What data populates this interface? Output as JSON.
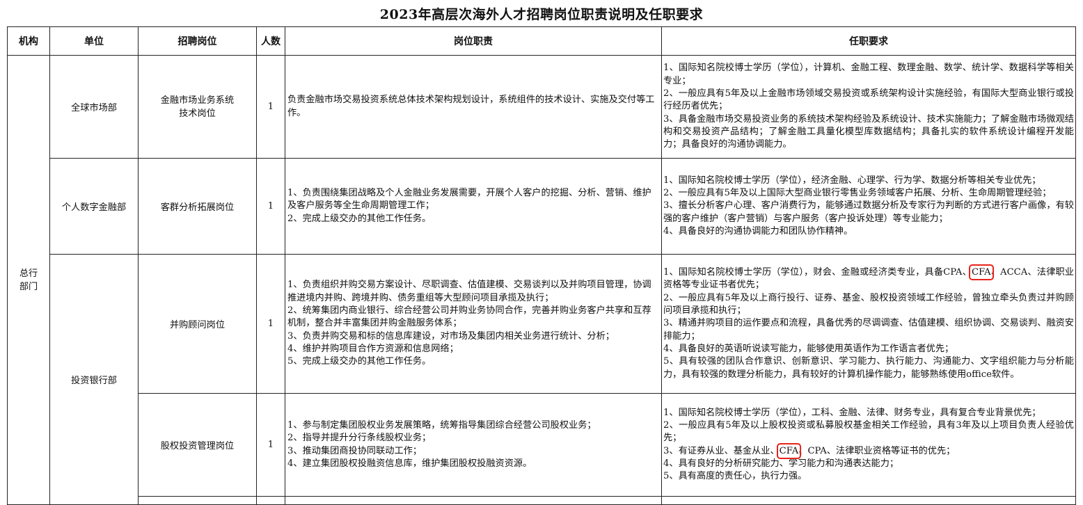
{
  "title": "2023年高层次海外人才招聘岗位职责说明及任职要求",
  "headers": {
    "org": "机构",
    "unit": "单位",
    "position": "招聘岗位",
    "count": "人数",
    "duties": "岗位职责",
    "requirements": "任职要求"
  },
  "org_name_line1": "总行",
  "org_name_line2": "部门",
  "rows": [
    {
      "unit": "全球市场部",
      "position_line1": "金融市场业务系统",
      "position_line2": "技术岗位",
      "count": "1",
      "duties": [
        "负责金融市场交易投资系统总体技术架构规划设计，系统组件的技术设计、实施及交付等工作。"
      ],
      "requirements": [
        "1、国际知名院校博士学历（学位），计算机、金融工程、数理金融、数学、统计学、数据科学等相关专业；",
        "2、一般应具有5年及以上金融市场领域交易投资或系统架构设计实施经验，有国际大型商业银行或投行经历者优先；",
        "3、具备金融市场交易投资业务的系统技术架构经验及系统设计、技术实施能力；了解金融市场微观结构和交易投资产品结构；了解金融工具量化模型库数据结构；具备扎实的软件系统设计编程开发能力；具备良好的沟通协调能力。"
      ]
    },
    {
      "unit": "个人数字金融部",
      "position_line1": "客群分析拓展岗位",
      "count": "1",
      "duties": [
        "1、负责围绕集团战略及个人金融业务发展需要，开展个人客户的挖掘、分析、营销、维护及客户服务等全生命周期管理工作；",
        "2、完成上级交办的其他工作任务。"
      ],
      "requirements": [
        "1、国际知名院校博士学历（学位），经济金融、心理学、行为学、数据分析等相关专业优先；",
        "2、一般应具有5年及以上国际大型商业银行零售业务领域客户拓展、分析、生命周期管理经验；",
        "3、擅长分析客户心理、客户消费行为，能够通过数据分析及专家行为判断的方式进行客户画像，有较强的客户维护（客户营销）与客户服务（客户投诉处理）等专业能力；",
        "4、具备良好的沟通协调能力和团队协作精神。"
      ]
    },
    {
      "unit": "投资银行部",
      "position_line1": "并购顾问岗位",
      "count": "1",
      "duties": [
        "1、负责组织并购交易方案设计、尽职调查、估值建模、交易谈判以及并购项目管理，协调推进境内并购、跨境并购、债务重组等大型顾问项目承揽及执行；",
        "2、统筹集团内商业银行、综合经营公司并购业务协同合作，完善并购业务客户共享和互荐机制，整合并丰富集团并购金融服务体系；",
        "3、负责并购交易和标的信息库建设，对市场及集团内相关业务进行统计、分析；",
        "4、维护并购项目合作方资源和信息网络；",
        "5、完成上级交办的其他工作任务。"
      ],
      "req1_pre": "1、国际知名院校博士学历（学位），财会、金融或经济类专业，具备CPA、",
      "req1_hl": "CFA",
      "req1_post": "、ACCA、法律职业资格等专业证书者优先；",
      "requirements": [
        "2、一般应具有5年及以上商行投行、证券、基金、股权投资领域工作经验，曾独立牵头负责过并购顾问项目承揽和执行；",
        "3、精通并购项目的运作要点和流程，具备优秀的尽调调查、估值建模、组织协调、交易谈判、融资安排能力；",
        "4、具备良好的英语听说读写能力，能够使用英语作为工作语言者优先；",
        "5、具有较强的团队合作意识、创新意识、学习能力、执行能力、沟通能力、文字组织能力与分析能力，具有较强的数理分析能力，具有较好的计算机操作能力，能够熟练使用office软件。"
      ]
    },
    {
      "position_line1": "股权投资管理岗位",
      "count": "1",
      "duties": [
        "1、参与制定集团股权业务发展策略，统筹指导集团综合经营公司股权业务；",
        "2、指导并提升分行条线股权业务；",
        "3、推动集团商投协同联动工作；",
        "4、建立集团股权投融资信息库，维护集团股权投融资资源。"
      ],
      "req_a": [
        "1、国际知名院校博士学历（学位），工科、金融、法律、财务专业，具有复合专业背景优先；",
        "2、一般应具有5年及以上股权投资或私募股权基金相关工作经验，具有3年及以上项目负责人经验优先；"
      ],
      "req3_pre": "3、有证券从业、基金从业、",
      "req3_hl": "CFA",
      "req3_post": "、CPA、法律职业资格等证书的优先；",
      "req_b": [
        "4、具有良好的分析研究能力、学习能力和沟通表达能力；",
        "5、具有高度的责任心，执行力强。"
      ]
    }
  ]
}
